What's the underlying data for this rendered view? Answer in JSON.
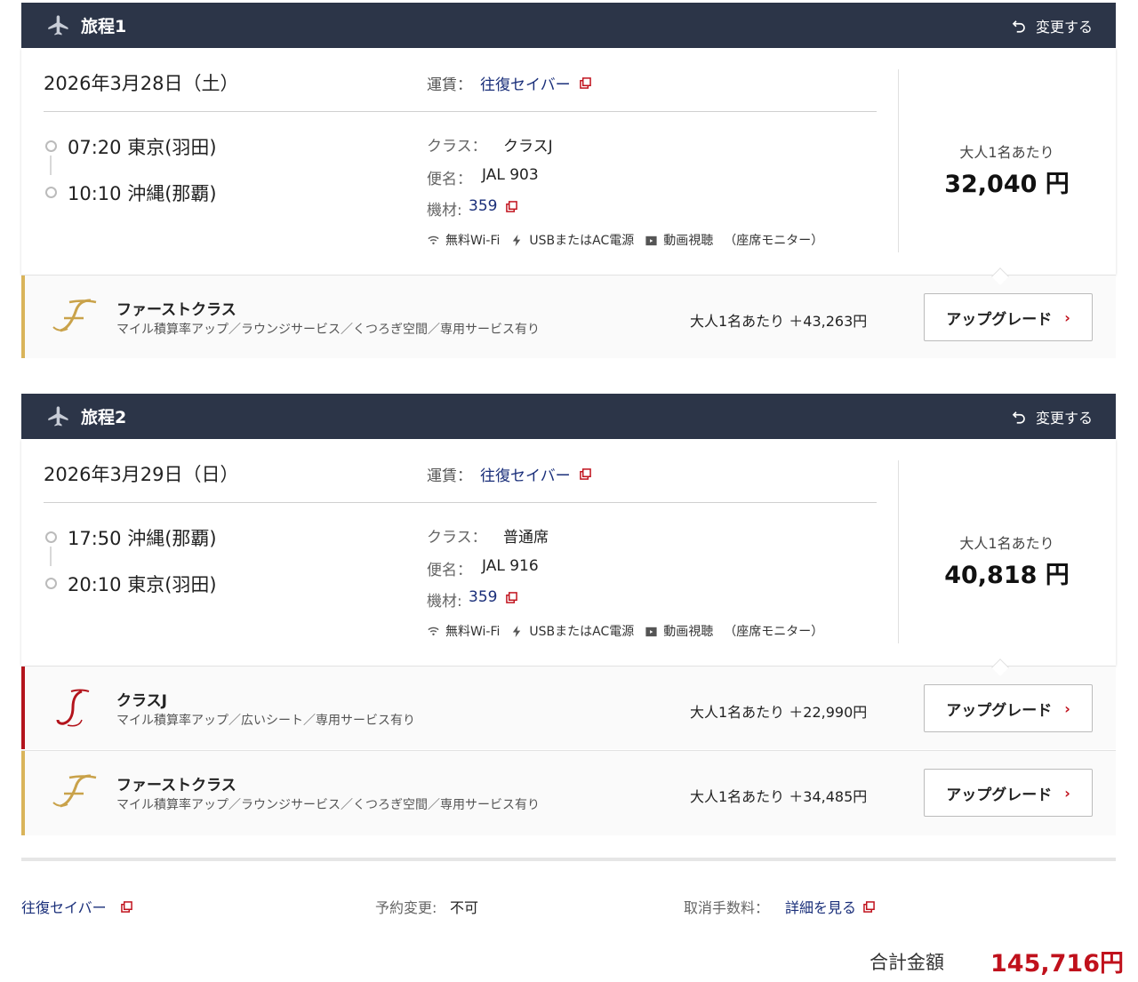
{
  "segments": [
    {
      "title": "旅程1",
      "change_label": "変更する",
      "date": "2026年3月28日（土）",
      "fare_label": "運賃：",
      "fare_name": "往復セイバー",
      "departure": "07:20 東京(羽田)",
      "arrival": "10:10 沖縄(那覇)",
      "class_label": "クラス：",
      "class_value": "クラスJ",
      "flight_label": "便名：",
      "flight_value": "JAL 903",
      "aircraft_label": "機材:",
      "aircraft_value": "359",
      "amenities": [
        "無料Wi-Fi",
        "USBまたはAC電源",
        "動画視聴",
        "（座席モニター）"
      ],
      "per_adult": "大人1名あたり",
      "price": "32,040 円",
      "upgrades": [
        {
          "name": "ファーストクラス",
          "desc": "マイル積算率アップ／ラウンジサービス／くつろぎ空間／専用サービス有り",
          "price": "大人1名あたり ＋43,263円",
          "button": "アップグレード",
          "accent": "#d9b45a",
          "logo": "F"
        }
      ]
    },
    {
      "title": "旅程2",
      "change_label": "変更する",
      "date": "2026年3月29日（日）",
      "fare_label": "運賃：",
      "fare_name": "往復セイバー",
      "departure": "17:50 沖縄(那覇)",
      "arrival": "20:10 東京(羽田)",
      "class_label": "クラス：",
      "class_value": "普通席",
      "flight_label": "便名：",
      "flight_value": "JAL 916",
      "aircraft_label": "機材:",
      "aircraft_value": "359",
      "amenities": [
        "無料Wi-Fi",
        "USBまたはAC電源",
        "動画視聴",
        "（座席モニター）"
      ],
      "per_adult": "大人1名あたり",
      "price": "40,818 円",
      "upgrades": [
        {
          "name": "クラスJ",
          "desc": "マイル積算率アップ／広いシート／専用サービス有り",
          "price": "大人1名あたり ＋22,990円",
          "button": "アップグレード",
          "accent": "#b3141c",
          "logo": "J"
        },
        {
          "name": "ファーストクラス",
          "desc": "マイル積算率アップ／ラウンジサービス／くつろぎ空間／専用サービス有り",
          "price": "大人1名あたり ＋34,485円",
          "button": "アップグレード",
          "accent": "#d9b45a",
          "logo": "F"
        }
      ]
    }
  ],
  "footer": {
    "fare_name": "往復セイバー",
    "change_label": "予約変更:",
    "change_value": "不可",
    "cancel_label": "取消手数料：",
    "cancel_link": "詳細を見る",
    "total_label": "合計金額",
    "total_value": "145,716円"
  },
  "colors": {
    "header_bg": "#2c3548",
    "link": "#1a2f7a",
    "accent_red": "#c0111c",
    "first_gold": "#d9b45a",
    "classj_red": "#b3141c"
  }
}
